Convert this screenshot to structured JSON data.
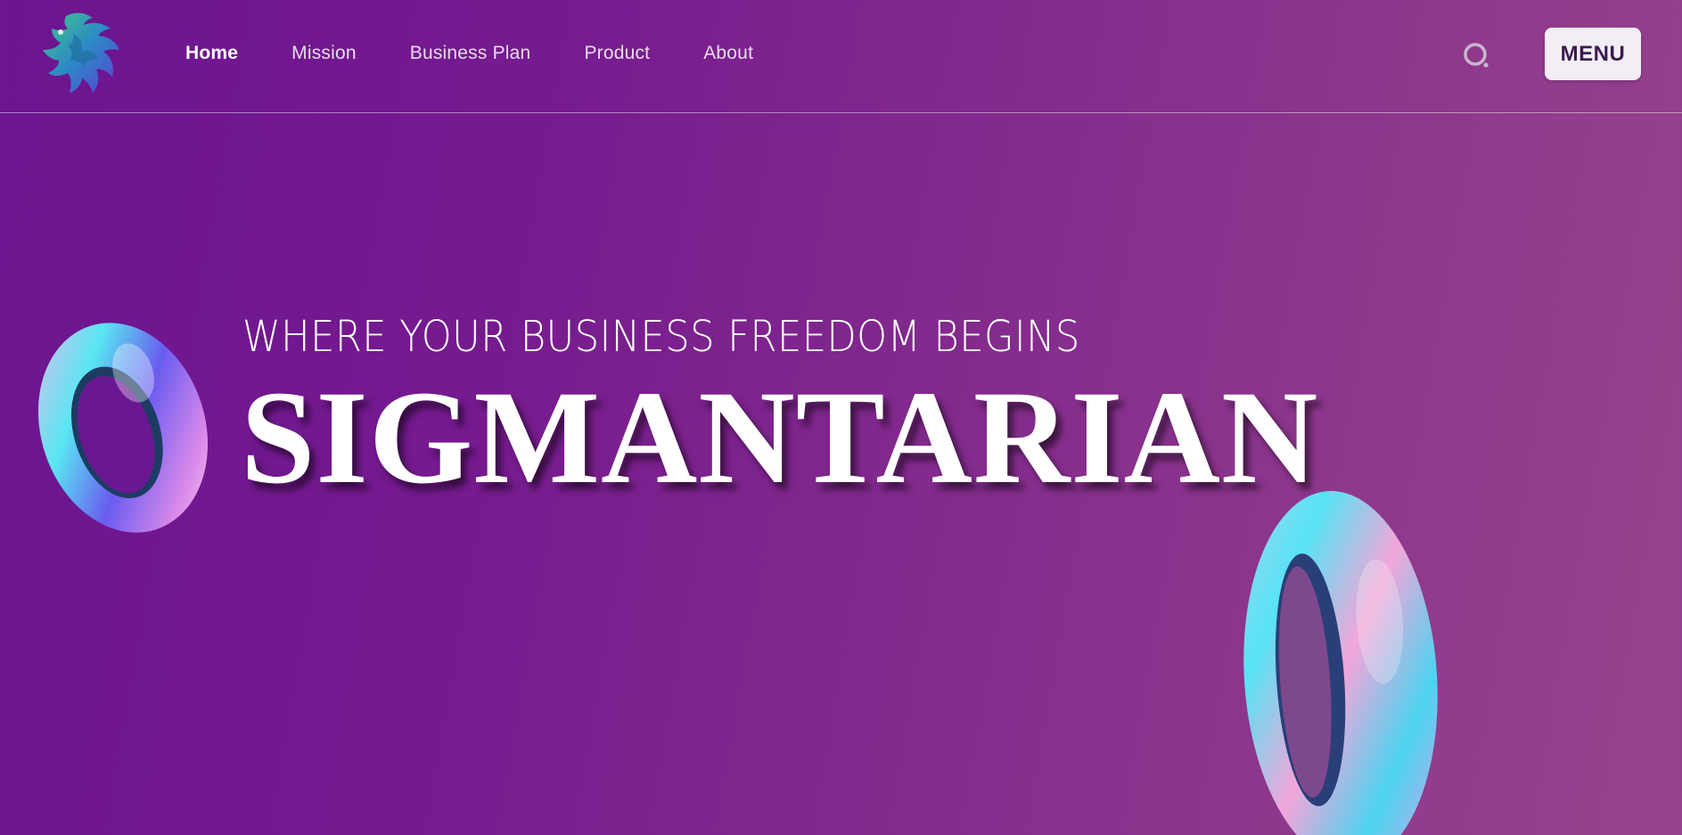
{
  "header": {
    "logo_icon": "dragon-logo-icon",
    "nav": [
      {
        "label": "Home",
        "active": true
      },
      {
        "label": "Mission",
        "active": false
      },
      {
        "label": "Business Plan",
        "active": false
      },
      {
        "label": "Product",
        "active": false
      },
      {
        "label": "About",
        "active": false
      }
    ],
    "search_icon": "search-icon",
    "menu_label": "MENU"
  },
  "hero": {
    "tagline": "WHERE YOUR BUSINESS FREEDOM BEGINS",
    "title": "SIGMANTARIAN",
    "decorations": [
      "holographic-ring-icon",
      "holographic-ring-icon"
    ]
  },
  "colors": {
    "background_start": "#6b1590",
    "background_end": "#98448c",
    "menu_button_bg": "#f3eef6",
    "menu_button_text": "#3b1a4d",
    "nav_text": "#e9dcef"
  }
}
